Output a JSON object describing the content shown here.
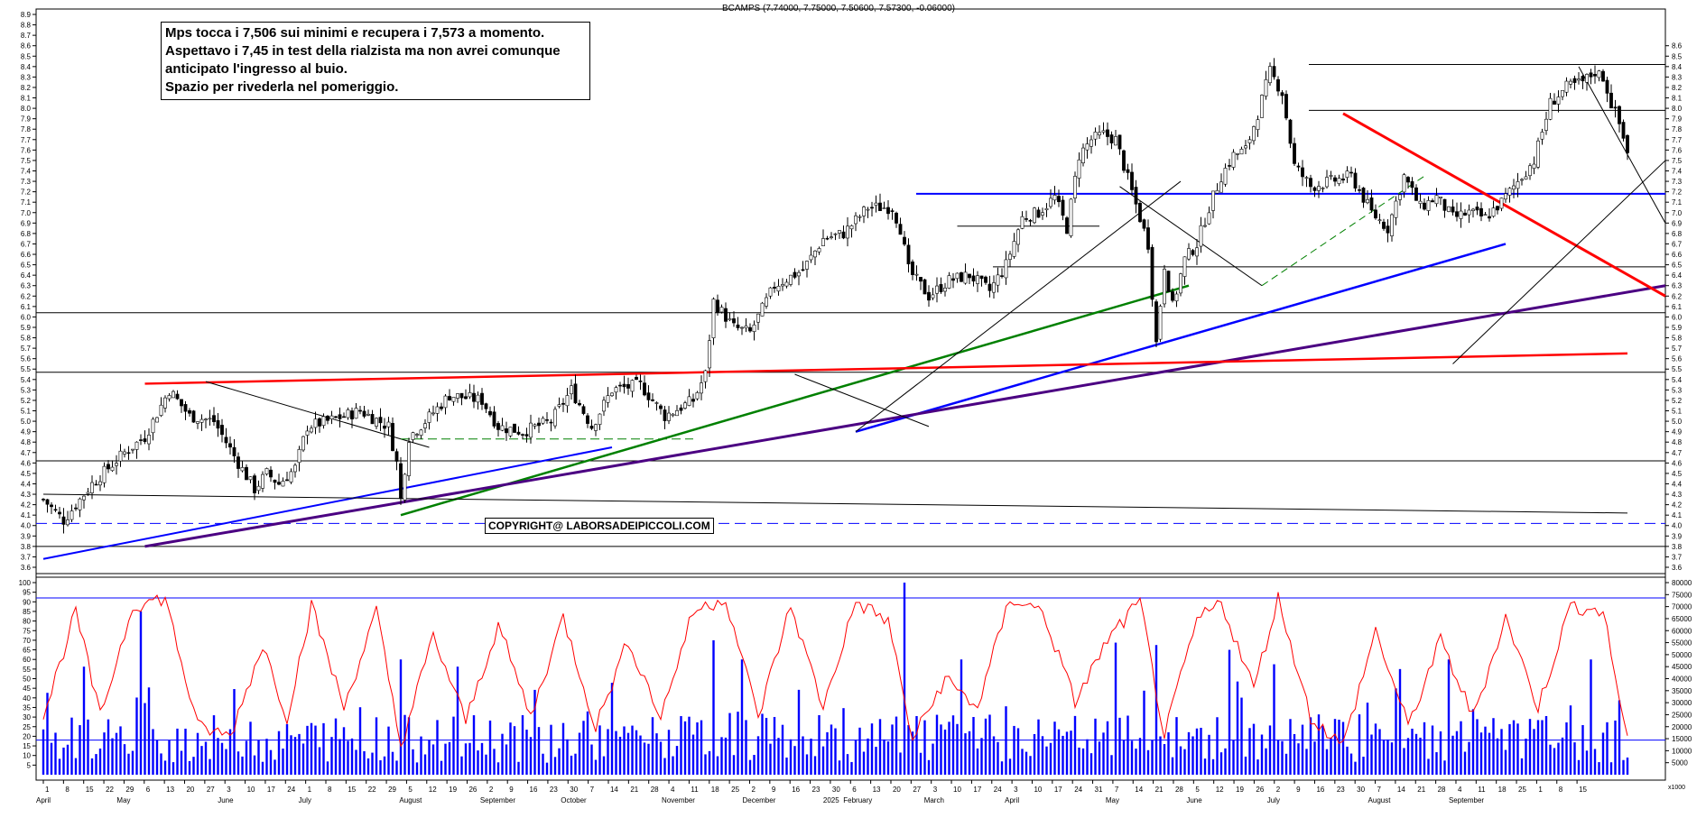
{
  "header": {
    "ohlc_label": "BCAMPS (7.74000, 7.75000, 7.50600, 7.57300, -0.06000)"
  },
  "annotation": {
    "lines": [
      "Mps tocca i 7,506 sui minimi e recupera i 7,573 a momento.",
      "Aspettavo i 7,45 in test della rialzista ma non avrei comunque",
      "anticipato l'ingresso al buio.",
      "Spazio per rivederla nel pomeriggio."
    ]
  },
  "copyright": "COPYRIGHT@ LABORSADEIPICCOLI.COM",
  "volume_unit": "x1000",
  "colors": {
    "candle": "#000000",
    "volume": "#0000ff",
    "oscillator": "#ff0000",
    "support": "#0000ff",
    "trend_red": "#ff0000",
    "trend_green": "#008000",
    "trend_purple": "#4b0082"
  },
  "chart_data": [
    {
      "type": "candlestick",
      "series": [
        {
          "name": "BCAMPS"
        }
      ],
      "ylim": [
        3.6,
        8.9
      ],
      "ticks": [
        "8.9",
        "8.8",
        "8.7",
        "8.6",
        "8.5",
        "8.4",
        "8.3",
        "8.2",
        "8.1",
        "8.0",
        "7.9",
        "7.8",
        "7.7",
        "7.6",
        "7.5",
        "7.4",
        "7.3",
        "7.2",
        "7.1",
        "7.0",
        "6.9",
        "6.8",
        "6.7",
        "6.6",
        "6.5",
        "6.4",
        "6.3",
        "6.2",
        "6.1",
        "6.0",
        "5.9",
        "5.8",
        "5.7",
        "5.6",
        "5.5",
        "5.4",
        "5.3",
        "5.2",
        "5.1",
        "5.0",
        "4.9",
        "4.8",
        "4.7",
        "4.6",
        "4.5",
        "4.4",
        "4.3",
        "4.2",
        "4.1",
        "4.0",
        "3.9",
        "3.8",
        "3.7",
        "3.6"
      ],
      "right_ticks": [
        "8.6",
        "8.5",
        "8.4",
        "8.3",
        "8.2",
        "8.1",
        "8.0",
        "7.9",
        "7.8",
        "7.7",
        "7.6",
        "7.5",
        "7.4",
        "7.3",
        "7.2",
        "7.1",
        "7.0",
        "6.9",
        "6.8",
        "6.7",
        "6.6",
        "6.5",
        "6.4",
        "6.3",
        "6.2",
        "6.1",
        "6.0",
        "5.9",
        "5.8",
        "5.7",
        "5.6",
        "5.5",
        "5.4",
        "5.3",
        "5.2",
        "5.1",
        "5.0",
        "4.9",
        "4.8",
        "4.7",
        "4.6",
        "4.5",
        "4.4",
        "4.3",
        "4.2",
        "4.1",
        "4.0",
        "3.9",
        "3.8",
        "3.7",
        "3.6"
      ],
      "horizontal_levels": [
        8.42,
        7.98,
        7.18,
        6.48,
        6.04,
        5.47,
        4.62,
        3.8
      ],
      "dashed_level": 4.02,
      "anchors": [
        {
          "d": 0,
          "c": 4.25
        },
        {
          "d": 5,
          "c": 4.05
        },
        {
          "d": 12,
          "c": 4.4
        },
        {
          "d": 20,
          "c": 4.7
        },
        {
          "d": 25,
          "c": 4.85
        },
        {
          "d": 31,
          "c": 5.3
        },
        {
          "d": 36,
          "c": 5.05
        },
        {
          "d": 42,
          "c": 5.0
        },
        {
          "d": 48,
          "c": 4.6
        },
        {
          "d": 52,
          "c": 4.35
        },
        {
          "d": 55,
          "c": 4.5
        },
        {
          "d": 58,
          "c": 4.4
        },
        {
          "d": 62,
          "c": 4.55
        },
        {
          "d": 65,
          "c": 4.95
        },
        {
          "d": 70,
          "c": 5.0
        },
        {
          "d": 78,
          "c": 5.1
        },
        {
          "d": 85,
          "c": 4.95
        },
        {
          "d": 87,
          "c": 4.6
        },
        {
          "d": 88,
          "c": 4.25
        },
        {
          "d": 90,
          "c": 4.85
        },
        {
          "d": 94,
          "c": 5.0
        },
        {
          "d": 100,
          "c": 5.25
        },
        {
          "d": 108,
          "c": 5.2
        },
        {
          "d": 112,
          "c": 4.95
        },
        {
          "d": 118,
          "c": 4.9
        },
        {
          "d": 125,
          "c": 5.0
        },
        {
          "d": 130,
          "c": 5.3
        },
        {
          "d": 135,
          "c": 4.95
        },
        {
          "d": 140,
          "c": 5.3
        },
        {
          "d": 147,
          "c": 5.35
        },
        {
          "d": 153,
          "c": 5.05
        },
        {
          "d": 160,
          "c": 5.2
        },
        {
          "d": 163,
          "c": 5.45
        },
        {
          "d": 165,
          "c": 6.15
        },
        {
          "d": 170,
          "c": 5.9
        },
        {
          "d": 174,
          "c": 5.85
        },
        {
          "d": 180,
          "c": 6.3
        },
        {
          "d": 187,
          "c": 6.45
        },
        {
          "d": 192,
          "c": 6.75
        },
        {
          "d": 197,
          "c": 6.8
        },
        {
          "d": 203,
          "c": 7.05
        },
        {
          "d": 209,
          "c": 7.05
        },
        {
          "d": 211,
          "c": 6.85
        },
        {
          "d": 213,
          "c": 6.45
        },
        {
          "d": 218,
          "c": 6.2
        },
        {
          "d": 223,
          "c": 6.35
        },
        {
          "d": 228,
          "c": 6.4
        },
        {
          "d": 233,
          "c": 6.25
        },
        {
          "d": 237,
          "c": 6.5
        },
        {
          "d": 241,
          "c": 6.95
        },
        {
          "d": 245,
          "c": 7.0
        },
        {
          "d": 249,
          "c": 7.15
        },
        {
          "d": 252,
          "c": 6.85
        },
        {
          "d": 255,
          "c": 7.55
        },
        {
          "d": 258,
          "c": 7.7
        },
        {
          "d": 261,
          "c": 7.75
        },
        {
          "d": 264,
          "c": 7.7
        },
        {
          "d": 268,
          "c": 7.2
        },
        {
          "d": 272,
          "c": 6.7
        },
        {
          "d": 274,
          "c": 5.75
        },
        {
          "d": 276,
          "c": 6.5
        },
        {
          "d": 278,
          "c": 6.1
        },
        {
          "d": 281,
          "c": 6.55
        },
        {
          "d": 284,
          "c": 6.7
        },
        {
          "d": 287,
          "c": 7.05
        },
        {
          "d": 290,
          "c": 7.35
        },
        {
          "d": 293,
          "c": 7.55
        },
        {
          "d": 296,
          "c": 7.6
        },
        {
          "d": 299,
          "c": 7.95
        },
        {
          "d": 302,
          "c": 8.35
        },
        {
          "d": 305,
          "c": 8.15
        },
        {
          "d": 308,
          "c": 7.45
        },
        {
          "d": 312,
          "c": 7.25
        },
        {
          "d": 317,
          "c": 7.3
        },
        {
          "d": 322,
          "c": 7.35
        },
        {
          "d": 327,
          "c": 7.0
        },
        {
          "d": 331,
          "c": 6.85
        },
        {
          "d": 335,
          "c": 7.35
        },
        {
          "d": 339,
          "c": 7.05
        },
        {
          "d": 343,
          "c": 7.15
        },
        {
          "d": 347,
          "c": 6.95
        },
        {
          "d": 351,
          "c": 7.0
        },
        {
          "d": 355,
          "c": 6.95
        },
        {
          "d": 359,
          "c": 7.1
        },
        {
          "d": 363,
          "c": 7.3
        },
        {
          "d": 367,
          "c": 7.5
        },
        {
          "d": 371,
          "c": 8.05
        },
        {
          "d": 375,
          "c": 8.2
        },
        {
          "d": 379,
          "c": 8.25
        },
        {
          "d": 382,
          "c": 8.35
        },
        {
          "d": 384,
          "c": 8.3
        },
        {
          "d": 386,
          "c": 8.05
        },
        {
          "d": 388,
          "c": 7.85
        },
        {
          "d": 390,
          "c": 7.573
        }
      ],
      "last_candle": {
        "open": 7.74,
        "high": 7.75,
        "low": 7.506,
        "close": 7.573
      }
    },
    {
      "type": "volume_oscillator",
      "series": [
        {
          "name": "oscillator"
        },
        {
          "name": "volume"
        }
      ],
      "osc_ylim": [
        0,
        100
      ],
      "osc_ticks": [
        "100",
        "95",
        "90",
        "85",
        "80",
        "75",
        "70",
        "65",
        "60",
        "55",
        "50",
        "45",
        "40",
        "35",
        "30",
        "25",
        "20",
        "15",
        "10",
        "5"
      ],
      "vol_ylim": [
        0,
        80000
      ],
      "vol_ticks": [
        "80000",
        "75000",
        "70000",
        "65000",
        "60000",
        "55000",
        "50000",
        "45000",
        "40000",
        "35000",
        "30000",
        "25000",
        "20000",
        "15000",
        "10000",
        "5000"
      ],
      "levels": [
        92,
        18
      ],
      "osc_anchors": [
        {
          "d": 0,
          "v": 30
        },
        {
          "d": 8,
          "v": 85
        },
        {
          "d": 14,
          "v": 30
        },
        {
          "d": 22,
          "v": 88
        },
        {
          "d": 30,
          "v": 92
        },
        {
          "d": 38,
          "v": 25
        },
        {
          "d": 46,
          "v": 20
        },
        {
          "d": 54,
          "v": 68
        },
        {
          "d": 60,
          "v": 30
        },
        {
          "d": 66,
          "v": 88
        },
        {
          "d": 74,
          "v": 35
        },
        {
          "d": 82,
          "v": 85
        },
        {
          "d": 88,
          "v": 15
        },
        {
          "d": 96,
          "v": 72
        },
        {
          "d": 104,
          "v": 28
        },
        {
          "d": 112,
          "v": 78
        },
        {
          "d": 120,
          "v": 30
        },
        {
          "d": 128,
          "v": 82
        },
        {
          "d": 136,
          "v": 25
        },
        {
          "d": 144,
          "v": 70
        },
        {
          "d": 152,
          "v": 30
        },
        {
          "d": 160,
          "v": 85
        },
        {
          "d": 168,
          "v": 92
        },
        {
          "d": 176,
          "v": 30
        },
        {
          "d": 184,
          "v": 88
        },
        {
          "d": 192,
          "v": 35
        },
        {
          "d": 200,
          "v": 90
        },
        {
          "d": 208,
          "v": 80
        },
        {
          "d": 214,
          "v": 18
        },
        {
          "d": 222,
          "v": 50
        },
        {
          "d": 230,
          "v": 35
        },
        {
          "d": 238,
          "v": 92
        },
        {
          "d": 246,
          "v": 85
        },
        {
          "d": 254,
          "v": 38
        },
        {
          "d": 262,
          "v": 70
        },
        {
          "d": 270,
          "v": 90
        },
        {
          "d": 276,
          "v": 20
        },
        {
          "d": 284,
          "v": 80
        },
        {
          "d": 290,
          "v": 90
        },
        {
          "d": 298,
          "v": 45
        },
        {
          "d": 304,
          "v": 92
        },
        {
          "d": 312,
          "v": 30
        },
        {
          "d": 320,
          "v": 15
        },
        {
          "d": 328,
          "v": 75
        },
        {
          "d": 336,
          "v": 25
        },
        {
          "d": 344,
          "v": 70
        },
        {
          "d": 352,
          "v": 30
        },
        {
          "d": 360,
          "v": 82
        },
        {
          "d": 368,
          "v": 35
        },
        {
          "d": 376,
          "v": 88
        },
        {
          "d": 384,
          "v": 85
        },
        {
          "d": 390,
          "v": 18
        }
      ],
      "volume_spikes": [
        {
          "d": 10,
          "v": 45000
        },
        {
          "d": 24,
          "v": 68000
        },
        {
          "d": 88,
          "v": 48000
        },
        {
          "d": 102,
          "v": 45000
        },
        {
          "d": 165,
          "v": 56000
        },
        {
          "d": 172,
          "v": 48000
        },
        {
          "d": 212,
          "v": 80000
        },
        {
          "d": 226,
          "v": 48000
        },
        {
          "d": 264,
          "v": 55000
        },
        {
          "d": 274,
          "v": 54000
        },
        {
          "d": 292,
          "v": 52000
        },
        {
          "d": 303,
          "v": 46000
        },
        {
          "d": 334,
          "v": 44000
        },
        {
          "d": 346,
          "v": 48000
        },
        {
          "d": 381,
          "v": 48000
        },
        {
          "d": 388,
          "v": 31000
        }
      ]
    }
  ],
  "x_axis": [
    {
      "d": 0,
      "label": "April"
    },
    {
      "d": 3,
      "label": "8"
    },
    {
      "d": 10,
      "label": "15"
    },
    {
      "d": 17,
      "label": "22"
    },
    {
      "d": 24,
      "label": "29"
    },
    {
      "d": 26,
      "label": "6"
    },
    {
      "d": 33,
      "label": "13"
    },
    {
      "d": 40,
      "label": "20"
    },
    {
      "d": 47,
      "label": "27"
    },
    {
      "d": 54,
      "label": "3"
    },
    {
      "d": 61,
      "label": "10"
    },
    {
      "d": 68,
      "label": "17"
    },
    {
      "d": 75,
      "label": "24"
    },
    {
      "d": 82,
      "label": "1"
    },
    {
      "d": 89,
      "label": "8"
    },
    {
      "d": 96,
      "label": "15"
    },
    {
      "d": 103,
      "label": "22"
    },
    {
      "d": 110,
      "label": "29"
    },
    {
      "d": 117,
      "label": "5"
    },
    {
      "d": 124,
      "label": "12"
    },
    {
      "d": 131,
      "label": "19"
    },
    {
      "d": 138,
      "label": "26"
    },
    {
      "d": 145,
      "label": "2"
    },
    {
      "d": 152,
      "label": "9"
    },
    {
      "d": 159,
      "label": "16"
    },
    {
      "d": 166,
      "label": "23"
    },
    {
      "d": 173,
      "label": "30"
    },
    {
      "d": 180,
      "label": "7"
    },
    {
      "d": 187,
      "label": "14"
    },
    {
      "d": 194,
      "label": "21"
    },
    {
      "d": 201,
      "label": "28"
    },
    {
      "d": 208,
      "label": "4"
    },
    {
      "d": 215,
      "label": "11"
    },
    {
      "d": 222,
      "label": "18"
    },
    {
      "d": 229,
      "label": "25"
    },
    {
      "d": 236,
      "label": "2"
    },
    {
      "d": 243,
      "label": "9"
    },
    {
      "d": 250,
      "label": "16"
    },
    {
      "d": 257,
      "label": "23"
    },
    {
      "d": 264,
      "label": "30"
    },
    {
      "d": 271,
      "label": "6"
    },
    {
      "d": 278,
      "label": "13"
    },
    {
      "d": 285,
      "label": "20"
    },
    {
      "d": 292,
      "label": "2025"
    },
    {
      "d": 299,
      "label": "13"
    },
    {
      "d": 306,
      "label": "20"
    },
    {
      "d": 313,
      "label": "27"
    },
    {
      "d": 320,
      "label": "3"
    },
    {
      "d": 327,
      "label": "10"
    },
    {
      "d": 334,
      "label": "17"
    },
    {
      "d": 341,
      "label": "24"
    },
    {
      "d": 348,
      "label": "3"
    },
    {
      "d": 355,
      "label": "10"
    },
    {
      "d": 362,
      "label": "17"
    },
    {
      "d": 369,
      "label": "24"
    },
    {
      "d": 376,
      "label": "31"
    },
    {
      "d": 383,
      "label": "7"
    },
    {
      "d": 390,
      "label": "14"
    }
  ],
  "x_months": [
    {
      "d": 0,
      "label": "April"
    },
    {
      "d": 24,
      "label": "May"
    },
    {
      "d": 54,
      "label": "June"
    },
    {
      "d": 80,
      "label": "July"
    },
    {
      "d": 112,
      "label": "August"
    },
    {
      "d": 143,
      "label": "September"
    },
    {
      "d": 173,
      "label": "October"
    },
    {
      "d": 205,
      "label": "November"
    },
    {
      "d": 235,
      "label": "December"
    },
    {
      "d": 266,
      "label": "2025"
    },
    {
      "d": 298,
      "label": "February"
    },
    {
      "d": 327,
      "label": "March"
    },
    {
      "d": 352,
      "label": "April"
    },
    {
      "d": 386,
      "label": "May"
    },
    {
      "d": 418,
      "label": "June"
    },
    {
      "d": 448,
      "label": "July"
    },
    {
      "d": 478,
      "label": "August"
    },
    {
      "d": 509,
      "label": "September"
    }
  ],
  "x_day_labels": [
    "1",
    "8",
    "15",
    "22",
    "29",
    "6",
    "13",
    "20",
    "27",
    "3",
    "10",
    "17",
    "24",
    "1",
    "8",
    "15",
    "22",
    "29",
    "5",
    "12",
    "19",
    "26",
    "2",
    "9",
    "16",
    "23",
    "30",
    "7",
    "14",
    "21",
    "28",
    "4",
    "11",
    "18",
    "25",
    "2",
    "9",
    "16",
    "23",
    "30",
    "6",
    "13",
    "20",
    "27",
    "3",
    "10",
    "17",
    "24",
    "3",
    "10",
    "17",
    "24",
    "31",
    "7",
    "14",
    "21",
    "28",
    "5",
    "12",
    "19",
    "26",
    "2",
    "9",
    "16",
    "23",
    "30",
    "7",
    "14",
    "21",
    "28",
    "4",
    "11",
    "18",
    "25",
    "1",
    "8",
    "15"
  ]
}
